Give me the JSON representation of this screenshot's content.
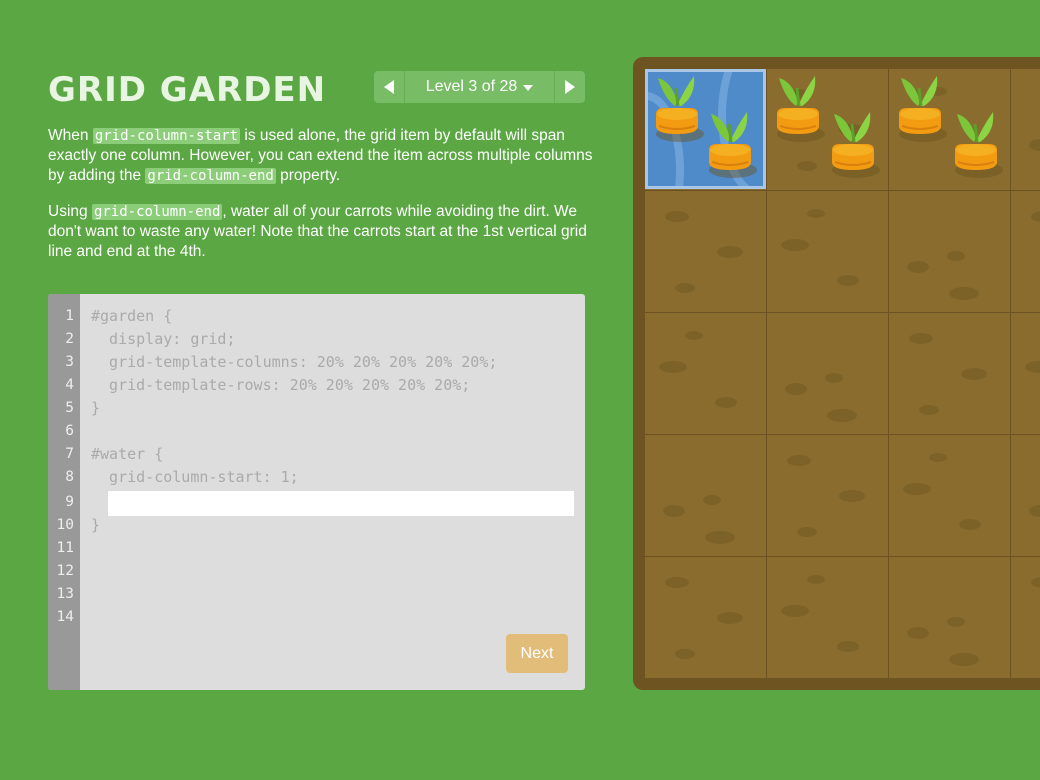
{
  "app": {
    "title": "GRID GARDEN",
    "level_label": "Level 3 of 28"
  },
  "instructions": {
    "p1": {
      "t1": "When ",
      "code1": "grid-column-start",
      "t2": " is used alone, the grid item by default will span exactly one column. However, you can extend the item across multiple columns by adding the ",
      "code2": "grid-column-end",
      "t3": " property."
    },
    "p2": {
      "t1": "Using ",
      "code1": "grid-column-end",
      "t2": ", water all of your carrots while avoiding the dirt. We don't want to waste any water! Note that the carrots start at the 1st vertical grid line and end at the 4th."
    }
  },
  "editor": {
    "line_numbers": [
      "1",
      "2",
      "3",
      "4",
      "5",
      "6",
      "7",
      "8",
      "9",
      "10",
      "11",
      "12",
      "13",
      "14"
    ],
    "lines": {
      "l1": "#garden {",
      "l2": "  display: grid;",
      "l3": "  grid-template-columns: 20% 20% 20% 20% 20%;",
      "l4": "  grid-template-rows: 20% 20% 20% 20% 20%;",
      "l5": "}",
      "l7": "#water {",
      "l8": "  grid-column-start: 1;",
      "l10": "}"
    },
    "input_value": "",
    "next_label": "Next"
  },
  "icons": {
    "prev": "triangle-left-icon",
    "next": "triangle-right-icon",
    "dropdown": "caret-down-icon",
    "carrot": "carrot-icon"
  },
  "colors": {
    "background": "#5ba743",
    "dirt": "#8a6d2e",
    "water": "#4f8ac9",
    "next_button": "#e2bd7a",
    "code_highlight": "#8ccd7a"
  }
}
